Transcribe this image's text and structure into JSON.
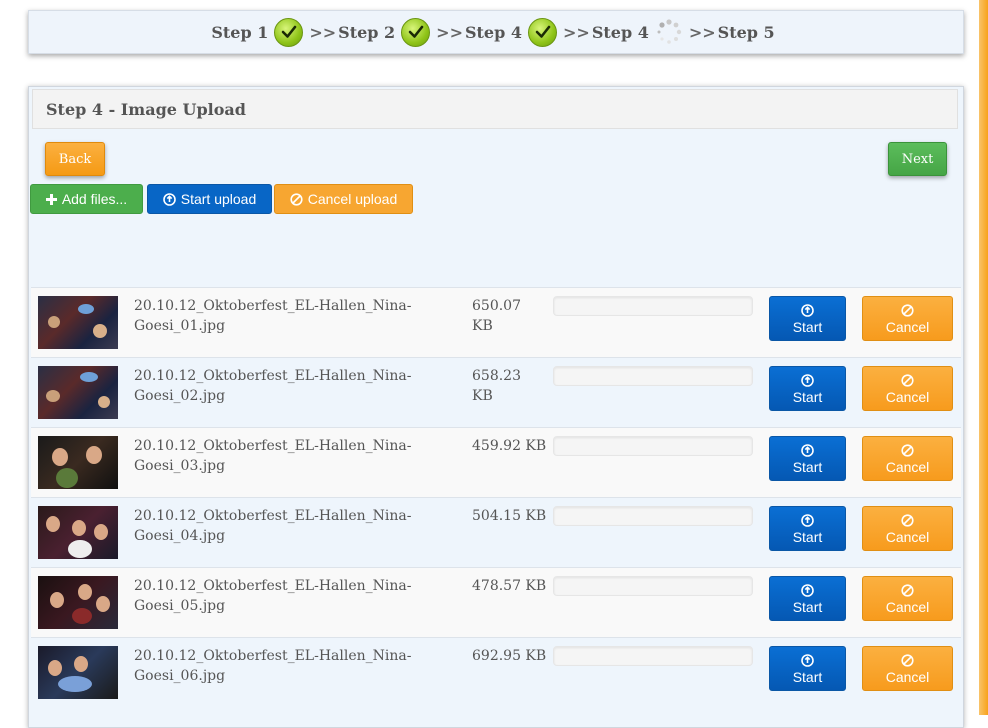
{
  "steps": [
    {
      "label": "Step 1",
      "status": "done"
    },
    {
      "label": "Step 2",
      "status": "done"
    },
    {
      "label": "Step 4",
      "status": "done"
    },
    {
      "label": "Step 4",
      "status": "loading"
    },
    {
      "label": "Step 5",
      "status": "pending"
    }
  ],
  "separator": ">>",
  "panel": {
    "title": "Step 4 - Image Upload"
  },
  "nav": {
    "back_label": "Back",
    "next_label": "Next"
  },
  "toolbar": {
    "add_label": "Add files...",
    "start_label": "Start upload",
    "cancel_label": "Cancel upload"
  },
  "row_buttons": {
    "start_label": "Start",
    "cancel_label": "Cancel"
  },
  "files": [
    {
      "name_line1": "20.10.12_Oktoberfest_EL-Hallen_Nina-",
      "name_line2": "Goesi_01.jpg",
      "size_line1": "650.07",
      "size_line2": "KB"
    },
    {
      "name_line1": "20.10.12_Oktoberfest_EL-Hallen_Nina-",
      "name_line2": "Goesi_02.jpg",
      "size_line1": "658.23",
      "size_line2": "KB"
    },
    {
      "name_line1": "20.10.12_Oktoberfest_EL-Hallen_Nina-",
      "name_line2": "Goesi_03.jpg",
      "size_line1": "459.92 KB",
      "size_line2": ""
    },
    {
      "name_line1": "20.10.12_Oktoberfest_EL-Hallen_Nina-",
      "name_line2": "Goesi_04.jpg",
      "size_line1": "504.15 KB",
      "size_line2": ""
    },
    {
      "name_line1": "20.10.12_Oktoberfest_EL-Hallen_Nina-",
      "name_line2": "Goesi_05.jpg",
      "size_line1": "478.57 KB",
      "size_line2": ""
    },
    {
      "name_line1": "20.10.12_Oktoberfest_EL-Hallen_Nina-",
      "name_line2": "Goesi_06.jpg",
      "size_line1": "692.95 KB",
      "size_line2": ""
    }
  ],
  "colors": {
    "green": "#4cae4c",
    "blue": "#0866c6",
    "orange": "#f7a631",
    "panel_bg": "#eef5fc"
  }
}
